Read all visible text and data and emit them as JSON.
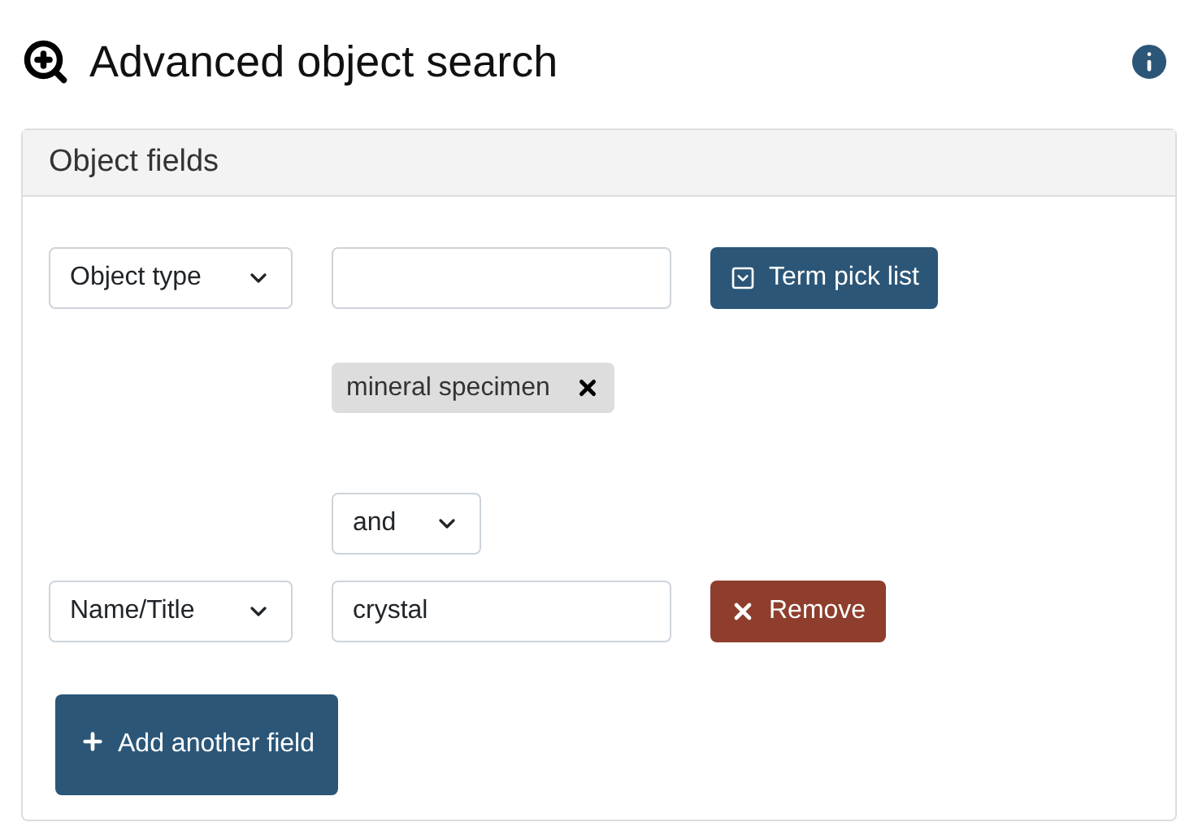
{
  "page": {
    "title": "Advanced object search"
  },
  "panel": {
    "title": "Object fields",
    "criteria": [
      {
        "field": "Object type",
        "action": {
          "kind": "picklist",
          "label": "Term pick list"
        },
        "terms": [
          "mineral specimen"
        ]
      },
      {
        "operator": "and",
        "field": "Name/Title",
        "value": "crystal",
        "action": {
          "kind": "remove",
          "label": "Remove"
        }
      }
    ],
    "add_button": "Add another field"
  }
}
